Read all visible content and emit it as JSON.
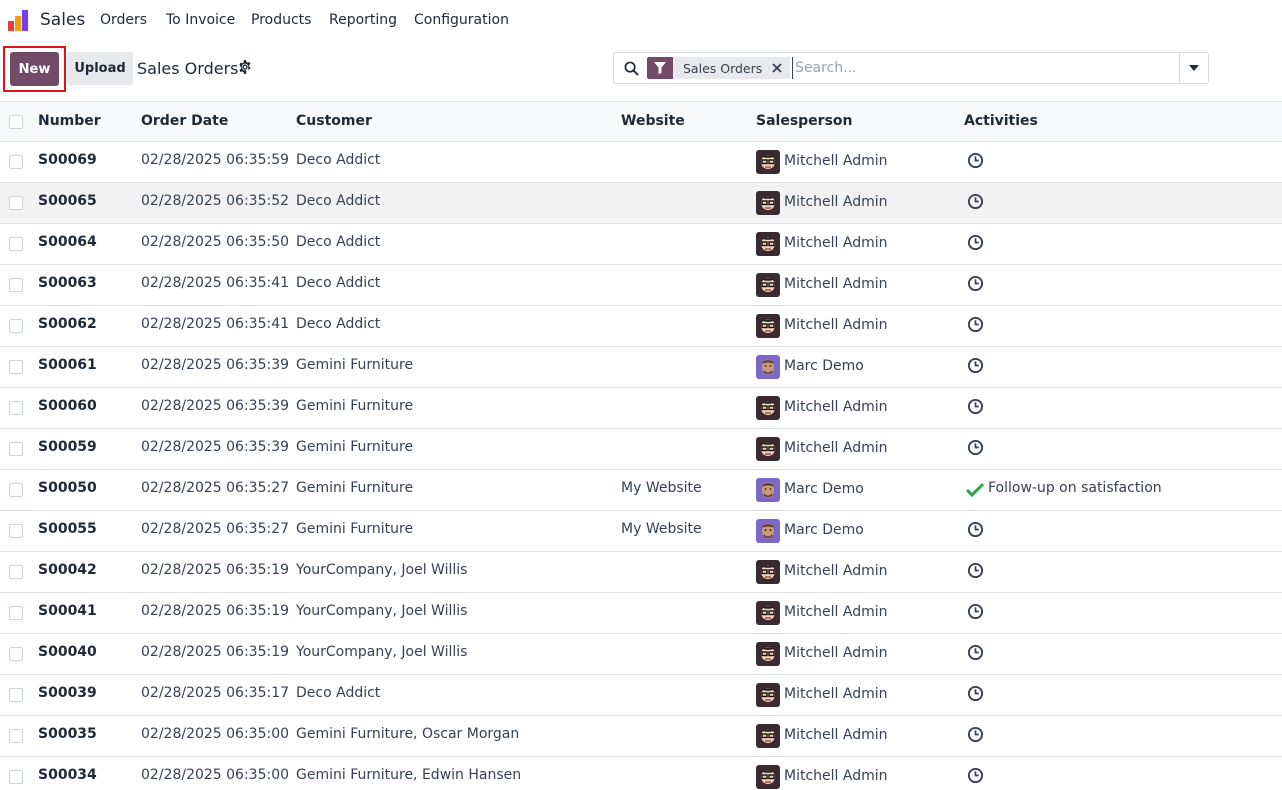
{
  "app": {
    "name": "Sales"
  },
  "menu": [
    "Orders",
    "To Invoice",
    "Products",
    "Reporting",
    "Configuration"
  ],
  "control": {
    "new_label": "New",
    "upload_label": "Upload",
    "title": "Sales Orders"
  },
  "search": {
    "facet_value": "Sales Orders",
    "placeholder": "Search..."
  },
  "columns": [
    "Number",
    "Order Date",
    "Customer",
    "Website",
    "Salesperson",
    "Activities"
  ],
  "colors": {
    "brand": "#714b67",
    "highlight_border": "#e3131c",
    "done_check": "#28a745"
  },
  "rows": [
    {
      "number": "S00069",
      "date": "02/28/2025 06:35:59",
      "customer": "Deco Addict",
      "website": "",
      "salesperson": "Mitchell Admin",
      "avatar": "mitchell",
      "activity": "",
      "activity_icon": "clock-icon"
    },
    {
      "number": "S00065",
      "date": "02/28/2025 06:35:52",
      "customer": "Deco Addict",
      "website": "",
      "salesperson": "Mitchell Admin",
      "avatar": "mitchell",
      "activity": "",
      "activity_icon": "clock-icon"
    },
    {
      "number": "S00064",
      "date": "02/28/2025 06:35:50",
      "customer": "Deco Addict",
      "website": "",
      "salesperson": "Mitchell Admin",
      "avatar": "mitchell",
      "activity": "",
      "activity_icon": "clock-icon"
    },
    {
      "number": "S00063",
      "date": "02/28/2025 06:35:41",
      "customer": "Deco Addict",
      "website": "",
      "salesperson": "Mitchell Admin",
      "avatar": "mitchell",
      "activity": "",
      "activity_icon": "clock-icon"
    },
    {
      "number": "S00062",
      "date": "02/28/2025 06:35:41",
      "customer": "Deco Addict",
      "website": "",
      "salesperson": "Mitchell Admin",
      "avatar": "mitchell",
      "activity": "",
      "activity_icon": "clock-icon"
    },
    {
      "number": "S00061",
      "date": "02/28/2025 06:35:39",
      "customer": "Gemini Furniture",
      "website": "",
      "salesperson": "Marc Demo",
      "avatar": "marc",
      "activity": "",
      "activity_icon": "clock-icon"
    },
    {
      "number": "S00060",
      "date": "02/28/2025 06:35:39",
      "customer": "Gemini Furniture",
      "website": "",
      "salesperson": "Mitchell Admin",
      "avatar": "mitchell",
      "activity": "",
      "activity_icon": "clock-icon"
    },
    {
      "number": "S00059",
      "date": "02/28/2025 06:35:39",
      "customer": "Gemini Furniture",
      "website": "",
      "salesperson": "Mitchell Admin",
      "avatar": "mitchell",
      "activity": "",
      "activity_icon": "clock-icon"
    },
    {
      "number": "S00050",
      "date": "02/28/2025 06:35:27",
      "customer": "Gemini Furniture",
      "website": "My Website",
      "salesperson": "Marc Demo",
      "avatar": "marc",
      "activity": "Follow-up on satisfaction",
      "activity_icon": "check-icon"
    },
    {
      "number": "S00055",
      "date": "02/28/2025 06:35:27",
      "customer": "Gemini Furniture",
      "website": "My Website",
      "salesperson": "Marc Demo",
      "avatar": "marc",
      "activity": "",
      "activity_icon": "clock-icon"
    },
    {
      "number": "S00042",
      "date": "02/28/2025 06:35:19",
      "customer": "YourCompany, Joel Willis",
      "website": "",
      "salesperson": "Mitchell Admin",
      "avatar": "mitchell",
      "activity": "",
      "activity_icon": "clock-icon"
    },
    {
      "number": "S00041",
      "date": "02/28/2025 06:35:19",
      "customer": "YourCompany, Joel Willis",
      "website": "",
      "salesperson": "Mitchell Admin",
      "avatar": "mitchell",
      "activity": "",
      "activity_icon": "clock-icon"
    },
    {
      "number": "S00040",
      "date": "02/28/2025 06:35:19",
      "customer": "YourCompany, Joel Willis",
      "website": "",
      "salesperson": "Mitchell Admin",
      "avatar": "mitchell",
      "activity": "",
      "activity_icon": "clock-icon"
    },
    {
      "number": "S00039",
      "date": "02/28/2025 06:35:17",
      "customer": "Deco Addict",
      "website": "",
      "salesperson": "Mitchell Admin",
      "avatar": "mitchell",
      "activity": "",
      "activity_icon": "clock-icon"
    },
    {
      "number": "S00035",
      "date": "02/28/2025 06:35:00",
      "customer": "Gemini Furniture, Oscar Morgan",
      "website": "",
      "salesperson": "Mitchell Admin",
      "avatar": "mitchell",
      "activity": "",
      "activity_icon": "clock-icon"
    },
    {
      "number": "S00034",
      "date": "02/28/2025 06:35:00",
      "customer": "Gemini Furniture, Edwin Hansen",
      "website": "",
      "salesperson": "Mitchell Admin",
      "avatar": "mitchell",
      "activity": "",
      "activity_icon": "clock-icon"
    }
  ]
}
